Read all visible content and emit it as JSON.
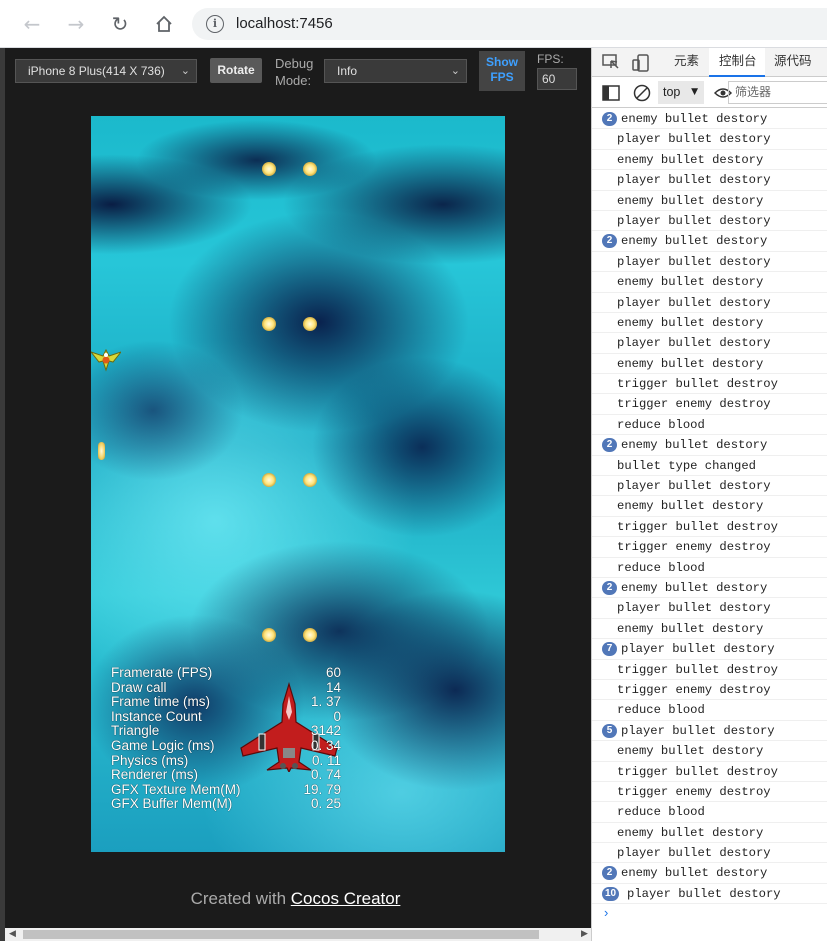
{
  "browser": {
    "url": "localhost:7456",
    "back_icon": "arrow-left-icon",
    "forward_icon": "arrow-right-icon",
    "reload_icon": "reload-icon",
    "home_icon": "home-icon",
    "info_icon": "info-icon"
  },
  "preview_toolbar": {
    "device": "iPhone 8 Plus(414 X 736)",
    "rotate_label": "Rotate",
    "debug_mode_label": "Debug Mode:",
    "debug_mode_value": "Info",
    "show_fps_label": "Show FPS",
    "fps_label": "FPS:",
    "fps_value": "60"
  },
  "stats": [
    {
      "label": "Framerate (FPS)",
      "value": "60"
    },
    {
      "label": "Draw call",
      "value": "14"
    },
    {
      "label": "Frame time (ms)",
      "value": "1. 37"
    },
    {
      "label": "Instance Count",
      "value": "0"
    },
    {
      "label": "Triangle",
      "value": "3142"
    },
    {
      "label": "Game Logic (ms)",
      "value": "0. 34"
    },
    {
      "label": "Physics (ms)",
      "value": "0. 11"
    },
    {
      "label": "Renderer (ms)",
      "value": "0. 74"
    },
    {
      "label": "GFX Texture Mem(M)",
      "value": "19. 79"
    },
    {
      "label": "GFX Buffer Mem(M)",
      "value": "0. 25"
    }
  ],
  "footer": {
    "prefix": "Created with",
    "link": "Cocos Creator"
  },
  "devtools": {
    "tabs": [
      "元素",
      "控制台",
      "源代码"
    ],
    "active_tab": "控制台",
    "context": "top",
    "filter_placeholder": "筛选器",
    "accent": "#1a73e8",
    "logs": [
      {
        "count": "2",
        "text": "enemy bullet destory"
      },
      {
        "count": "",
        "text": "player bullet destory"
      },
      {
        "count": "",
        "text": "enemy bullet destory"
      },
      {
        "count": "",
        "text": "player bullet destory"
      },
      {
        "count": "",
        "text": "enemy bullet destory"
      },
      {
        "count": "",
        "text": "player bullet destory"
      },
      {
        "count": "2",
        "text": "enemy bullet destory"
      },
      {
        "count": "",
        "text": "player bullet destory"
      },
      {
        "count": "",
        "text": "enemy bullet destory"
      },
      {
        "count": "",
        "text": "player bullet destory"
      },
      {
        "count": "",
        "text": "enemy bullet destory"
      },
      {
        "count": "",
        "text": "player bullet destory"
      },
      {
        "count": "",
        "text": "enemy bullet destory"
      },
      {
        "count": "",
        "text": "trigger bullet destroy"
      },
      {
        "count": "",
        "text": "trigger enemy destroy"
      },
      {
        "count": "",
        "text": "reduce blood"
      },
      {
        "count": "2",
        "text": "enemy bullet destory"
      },
      {
        "count": "",
        "text": "bullet type changed"
      },
      {
        "count": "",
        "text": "player bullet destory"
      },
      {
        "count": "",
        "text": "enemy bullet destory"
      },
      {
        "count": "",
        "text": "trigger bullet destroy"
      },
      {
        "count": "",
        "text": "trigger enemy destroy"
      },
      {
        "count": "",
        "text": "reduce blood"
      },
      {
        "count": "2",
        "text": "enemy bullet destory"
      },
      {
        "count": "",
        "text": "player bullet destory"
      },
      {
        "count": "",
        "text": "enemy bullet destory"
      },
      {
        "count": "7",
        "text": "player bullet destory"
      },
      {
        "count": "",
        "text": "trigger bullet destroy"
      },
      {
        "count": "",
        "text": "trigger enemy destroy"
      },
      {
        "count": "",
        "text": "reduce blood"
      },
      {
        "count": "5",
        "text": "player bullet destory"
      },
      {
        "count": "",
        "text": "enemy bullet destory"
      },
      {
        "count": "",
        "text": "trigger bullet destroy"
      },
      {
        "count": "",
        "text": "trigger enemy destroy"
      },
      {
        "count": "",
        "text": "reduce blood"
      },
      {
        "count": "",
        "text": "enemy bullet destory"
      },
      {
        "count": "",
        "text": "player bullet destory"
      },
      {
        "count": "2",
        "text": "enemy bullet destory"
      },
      {
        "count": "10",
        "text": "player bullet destory"
      }
    ],
    "prompt": "›"
  }
}
